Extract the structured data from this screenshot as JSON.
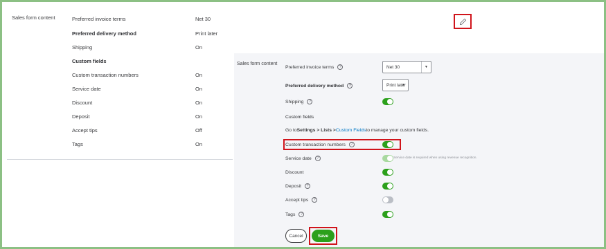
{
  "left": {
    "section_label": "Sales form content",
    "rows": [
      {
        "label": "Preferred invoice terms",
        "value": "Net 30"
      },
      {
        "label": "Preferred delivery method",
        "value": "Print later"
      },
      {
        "label": "Shipping",
        "value": "On"
      },
      {
        "label": "Custom fields",
        "value": ""
      },
      {
        "label": "Custom transaction numbers",
        "value": "On"
      },
      {
        "label": "Service date",
        "value": "On"
      },
      {
        "label": "Discount",
        "value": "On"
      },
      {
        "label": "Deposit",
        "value": "On"
      },
      {
        "label": "Accept tips",
        "value": "Off"
      },
      {
        "label": "Tags",
        "value": "On"
      }
    ]
  },
  "edit_icon": "pencil-icon",
  "right": {
    "section_label": "Sales form content",
    "invoice_terms_label": "Preferred invoice terms",
    "invoice_terms_value": "Net 30",
    "delivery_label": "Preferred delivery method",
    "delivery_value": "Print later",
    "shipping_label": "Shipping",
    "custom_fields_heading": "Custom fields",
    "custom_fields_text_prefix": "Go to ",
    "custom_fields_path": "Settings > Lists > ",
    "custom_fields_link": "Custom Fields",
    "custom_fields_text_suffix": " to manage your custom fields.",
    "custom_txn_label": "Custom transaction numbers",
    "service_date_label": "Service date",
    "service_date_hint": "Service date is required when using revenue recognition.",
    "discount_label": "Discount",
    "deposit_label": "Deposit",
    "tips_label": "Accept tips",
    "tags_label": "Tags",
    "help_glyph": "?",
    "toggles": {
      "shipping": true,
      "custom_txn": true,
      "service_date": true,
      "discount": true,
      "deposit": true,
      "tips": false,
      "tags": true
    }
  },
  "buttons": {
    "cancel": "Cancel",
    "save": "Save"
  },
  "colors": {
    "accent_green": "#2ca01c",
    "highlight_red": "#d0141b",
    "frame_green": "#8cc084",
    "link_blue": "#0077c5"
  }
}
